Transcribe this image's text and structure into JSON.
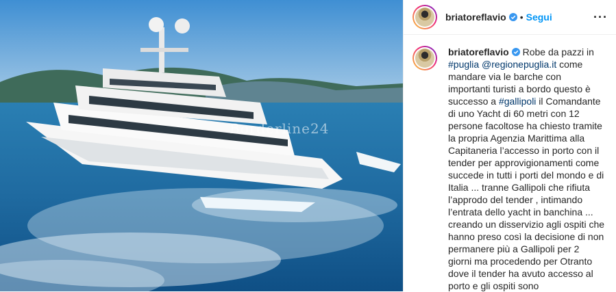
{
  "post": {
    "username": "briatoreflavio",
    "follow_label": "Segui",
    "separator": "•",
    "more_label": "···"
  },
  "media": {
    "watermark": "Borderline24"
  },
  "caption": {
    "username": "briatoreflavio",
    "t1": " Robe da pazzi in ",
    "tag_puglia": "#puglia",
    "t2": " ",
    "mention": "@regionepuglia.it",
    "t3": " come mandare via le barche con importanti turisti a bordo questo è successo a ",
    "tag_gallipoli": "#gallipoli",
    "t4": " il Comandante di uno Yacht di 60 metri con 12 persone facoltose ha chiesto tramite la propria Agenzia Marittima alla Capitaneria l’accesso in porto con il tender per approvigionamenti come succede in tutti i porti del mondo e di Italia ... tranne Gallipoli che rifiuta l’approdo del tender , intimando l’entrata dello yacht in banchina ... creando un disservizio agli ospiti che hanno preso così la decisione di non permanere più a Gallipoli per 2 giorni ma procedendo per Otranto dove il tender ha avuto accesso al porto e gli ospiti sono"
  },
  "colors": {
    "link": "#00376b",
    "follow": "#0095f6",
    "verified": "#3897f0"
  },
  "icons": [
    "verified-badge-icon",
    "more-options-icon"
  ]
}
